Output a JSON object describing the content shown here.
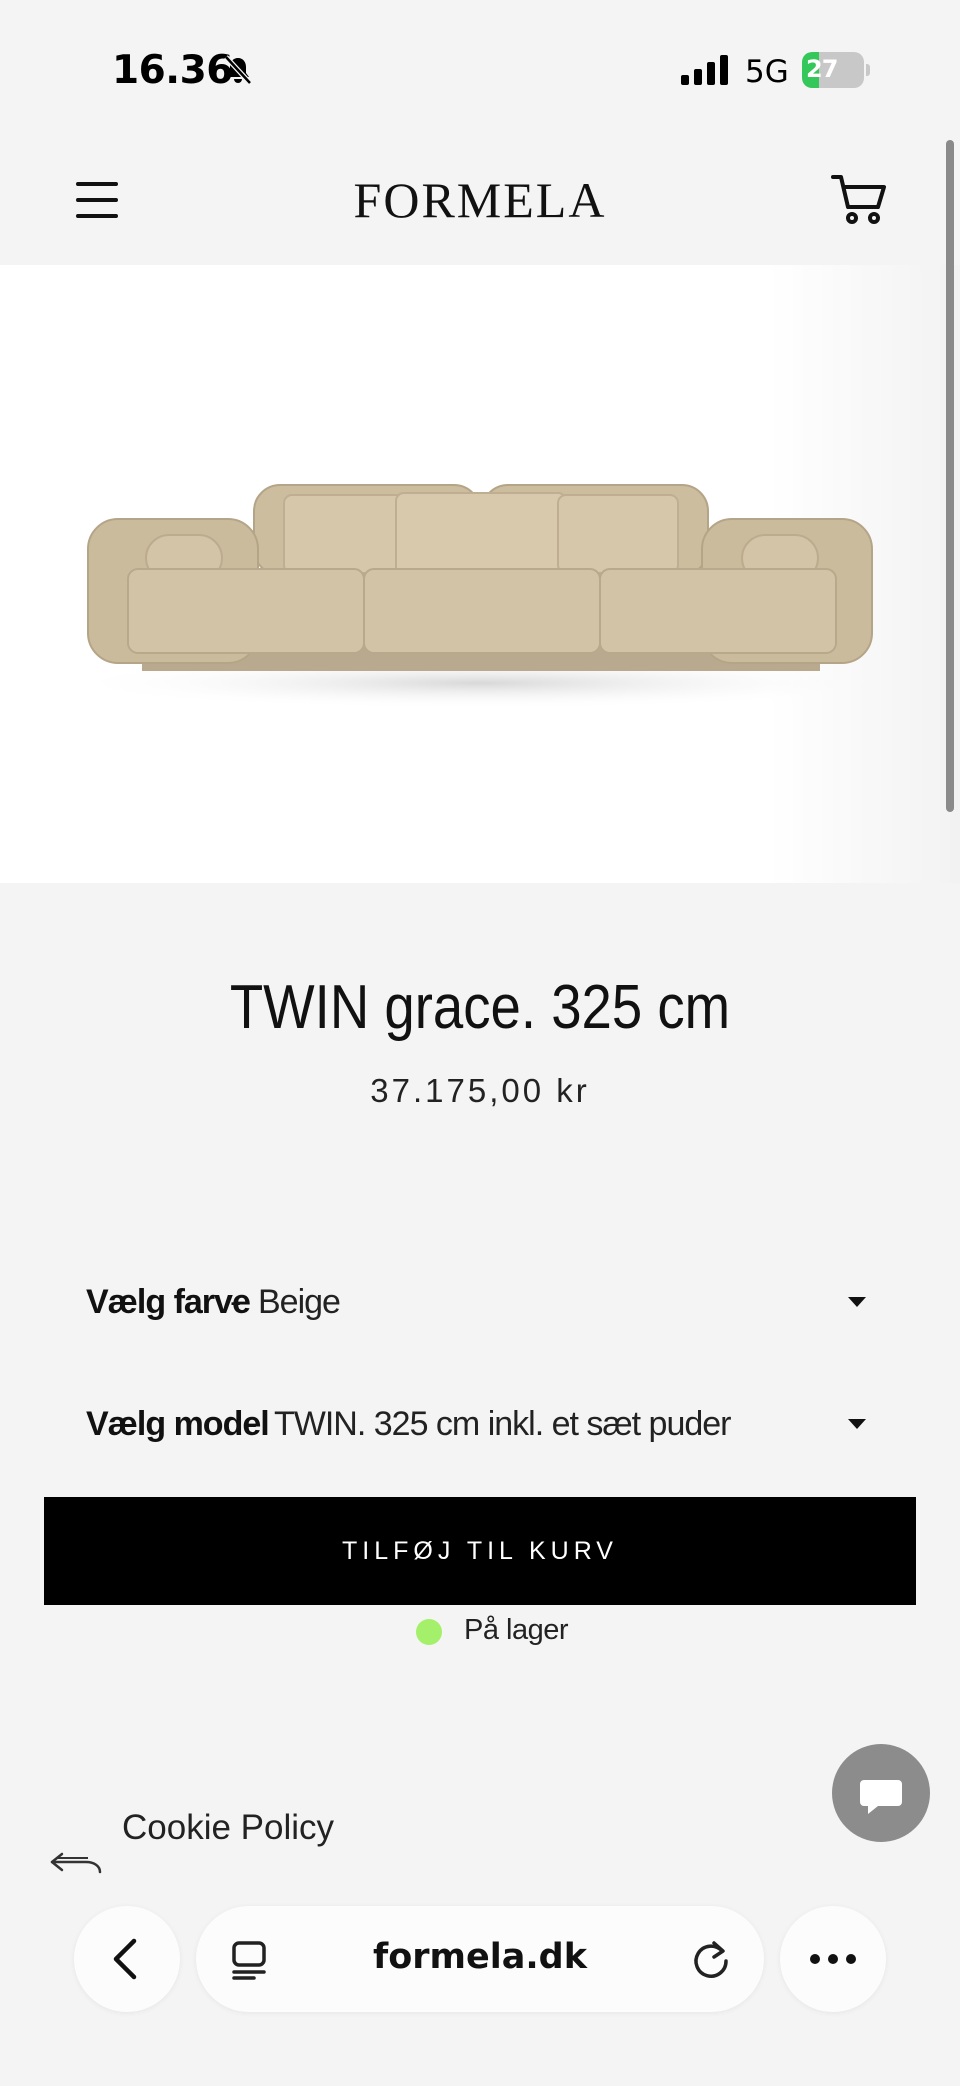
{
  "status_bar": {
    "time": "16.36",
    "network": "5G",
    "battery_level": "27",
    "battery_fraction": 0.27
  },
  "header": {
    "logo": "FORMELA",
    "menu_icon": "hamburger-menu-icon",
    "cart_icon": "shopping-cart-icon"
  },
  "product": {
    "image_alt": "sofa-image",
    "title": "TWIN grace. 325 cm",
    "price": "37.175,00 kr",
    "options": [
      {
        "label": "Vælg farve",
        "separator": "-",
        "value": "Beige"
      },
      {
        "label": "Vælg model",
        "separator": "-",
        "value": "TWIN. 325 cm inkl. et sæt puder"
      }
    ],
    "add_to_cart_label": "TILFØJ TIL KURV",
    "stock_label": "På lager",
    "stock_color": "#a4f06a"
  },
  "footer": {
    "cookie_policy": "Cookie Policy"
  },
  "browser": {
    "url": "formela.dk"
  },
  "colors": {
    "background": "#f4f4f4",
    "button": "#000000",
    "chat_button": "#8c8c8c",
    "sofa": "#d3c3a6"
  }
}
